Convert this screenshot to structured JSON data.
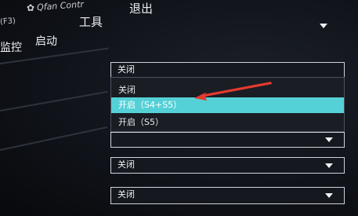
{
  "menubar": {
    "left_partial": "(F3)",
    "brand": "Qfan Contr",
    "tools": "工具",
    "exit": "退出"
  },
  "nav": {
    "monitor": "监控",
    "boot": "启动"
  },
  "selects": {
    "top_value": "",
    "dropdown_current": "关闭",
    "options": [
      "关闭",
      "开启（S4+S5）",
      "开启（S5）"
    ],
    "row2_value": "",
    "row3_value": "关闭",
    "row4_value": "关闭"
  },
  "colors": {
    "highlight": "#54d1d7",
    "arrow": "#e53a2f"
  }
}
